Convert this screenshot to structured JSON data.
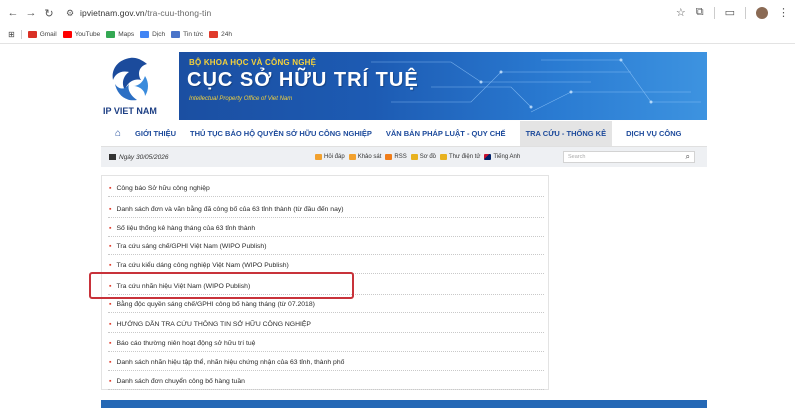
{
  "browser": {
    "url_host": "ipvietnam.gov.vn",
    "url_path": "/tra-cuu-thong-tin",
    "bookmarks": [
      {
        "label": "Gmail",
        "color": "#d93025"
      },
      {
        "label": "YouTube",
        "color": "#ff0000"
      },
      {
        "label": "Maps",
        "color": "#34a853"
      },
      {
        "label": "Dịch",
        "color": "#4285f4"
      },
      {
        "label": "Tin tức",
        "color": "#4a74c9"
      },
      {
        "label": "24h",
        "color": "#e03a2b"
      }
    ]
  },
  "banner": {
    "gov_line": "BỘ KHOA HỌC VÀ CÔNG NGHỆ",
    "title": "CỤC SỞ HỮU TRÍ TUỆ",
    "subtitle": "Intellectual Property Office of Viet Nam",
    "logo_text": "IP VIET NAM"
  },
  "menu": {
    "items": [
      {
        "label": "GIỚI THIỆU"
      },
      {
        "label": "THỦ TỤC BẢO HỘ QUYỀN SỞ HỮU CÔNG NGHIỆP"
      },
      {
        "label": "VĂN BẢN PHÁP LUẬT - QUY CHẾ"
      },
      {
        "label": "TRA CỨU - THỐNG KÊ"
      },
      {
        "label": "DỊCH VỤ CÔNG"
      }
    ]
  },
  "infobar": {
    "date": "Ngày 30/05/2026",
    "links": [
      "Hỏi đáp",
      "Khảo sát",
      "RSS",
      "Sơ đồ",
      "Thư điện tử",
      "Tiếng Anh"
    ],
    "search_placeholder": "Search"
  },
  "list": [
    "Công báo Sở hữu công nghiệp",
    "Danh sách đơn và văn bằng đã công bố của 63 tỉnh thành (từ đầu đến nay)",
    "Số liệu thống kê hàng tháng của 63 tỉnh thành",
    "Tra cứu sáng chế/GPHI Việt Nam (WIPO Publish)",
    "Tra cứu kiểu dáng công nghiệp Việt Nam (WIPO Publish)",
    "Tra cứu nhãn hiệu Việt Nam (WIPO Publish)",
    "Bằng độc quyền sáng chế/GPHI công bố hàng tháng (từ 07.2018)",
    "HƯỚNG DẪN TRA CỨU THÔNG TIN SỞ HỮU CÔNG NGHIỆP",
    "Báo cáo thường niên hoạt động sở hữu trí tuệ",
    "Danh sách nhãn hiệu tập thể, nhãn hiệu chứng nhận của 63 tỉnh, thành phố",
    "Danh sách đơn chuyển công bố hàng tuần"
  ]
}
